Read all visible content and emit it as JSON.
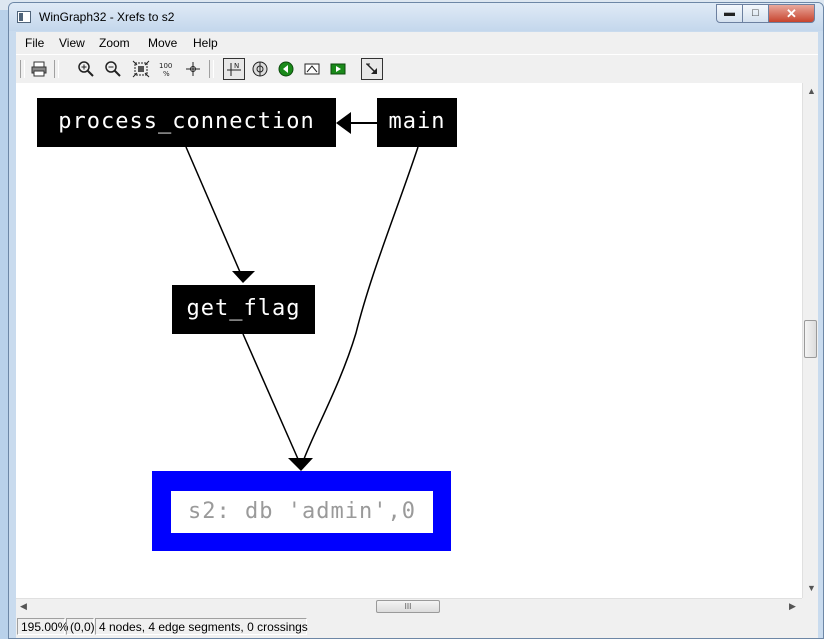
{
  "window": {
    "title": "WinGraph32 - Xrefs to s2",
    "minimize": "▬",
    "maximize": "□",
    "close": "✕"
  },
  "menu": [
    "File",
    "View",
    "Zoom",
    "Move",
    "Help"
  ],
  "toolbar": {
    "icons": [
      "print-icon",
      "zoom-in-icon",
      "zoom-out-icon",
      "fit-window-icon",
      "zoom-100-icon",
      "center-icon",
      "orthogonal-layout-icon",
      "radar-icon",
      "previous-node-icon",
      "rotate-icon",
      "next-node-icon",
      "arrow-mode-icon"
    ],
    "zoom_100_label": "100\n%"
  },
  "graph": {
    "nodes": {
      "process_connection": "process_connection",
      "main": "main",
      "get_flag": "get_flag",
      "s2": "s2: db 'admin',0"
    },
    "colors": {
      "node_bg": "#000000",
      "node_text": "#ffffff",
      "target_border": "#0000ff",
      "target_text": "#9a9a9a"
    }
  },
  "scrollbar": {
    "grip": "III"
  },
  "status": {
    "zoom": "195.00%",
    "coords": "(0,0)",
    "info": "4 nodes, 4 edge segments, 0 crossings"
  }
}
